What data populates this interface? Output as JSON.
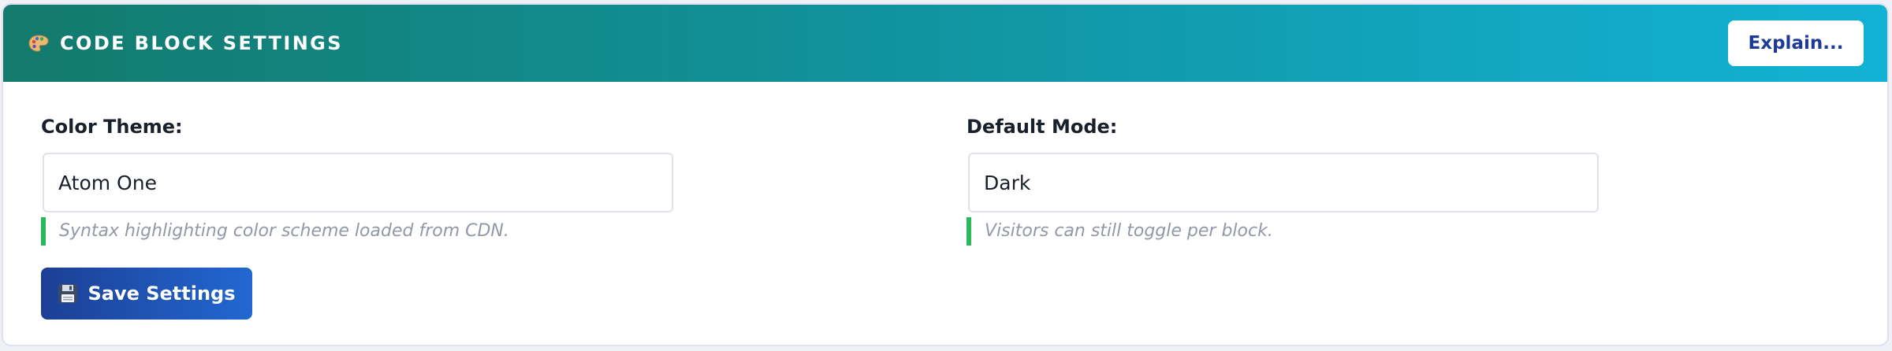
{
  "header": {
    "icon": "palette-icon",
    "title": "CODE BLOCK SETTINGS",
    "explain_label": "Explain..."
  },
  "fields": {
    "color_theme": {
      "label": "Color Theme:",
      "value": "Atom One",
      "hint": "Syntax highlighting color scheme loaded from CDN."
    },
    "default_mode": {
      "label": "Default Mode:",
      "value": "Dark",
      "hint": "Visitors can still toggle per block."
    }
  },
  "actions": {
    "save_icon": "floppy-disk-icon",
    "save_label": "Save Settings"
  },
  "colors": {
    "header_gradient_start": "#137a6c",
    "header_gradient_end": "#12b2d6",
    "explain_text": "#1d3a96",
    "hint_accent": "#2bb85c",
    "save_gradient_start": "#1c3f94",
    "save_gradient_end": "#2267d2"
  }
}
